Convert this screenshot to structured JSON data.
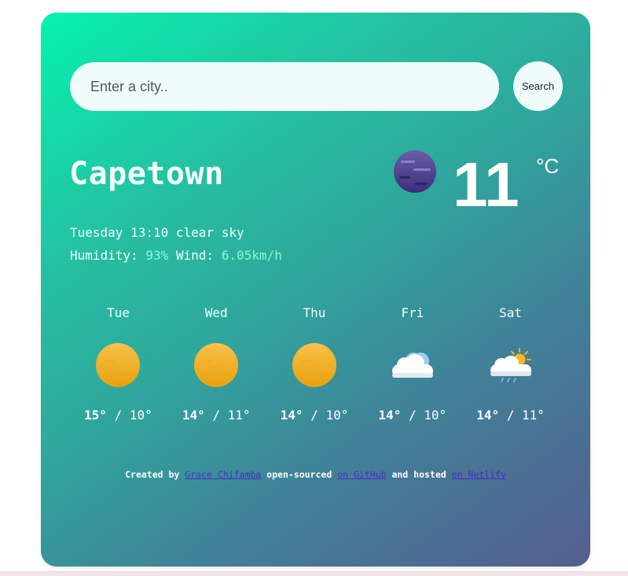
{
  "search": {
    "placeholder": "Enter a city..",
    "value": "",
    "button_label": "Search"
  },
  "current": {
    "city": "Capetown",
    "icon": "moon-icon",
    "temperature": "11",
    "unit": "°C",
    "day": "Tuesday",
    "time": "13:10",
    "description": "clear sky",
    "humidity_label": "Humidity:",
    "humidity": "93%",
    "wind_label": "Wind:",
    "wind": "6.05km/h"
  },
  "forecast": [
    {
      "day": "Tue",
      "icon": "sun-icon",
      "max": "15°",
      "min": "10°"
    },
    {
      "day": "Wed",
      "icon": "sun-icon",
      "max": "14°",
      "min": "11°"
    },
    {
      "day": "Thu",
      "icon": "sun-icon",
      "max": "14°",
      "min": "10°"
    },
    {
      "day": "Fri",
      "icon": "cloud-icon",
      "max": "14°",
      "min": "10°"
    },
    {
      "day": "Sat",
      "icon": "sun-cloud-rain-icon",
      "max": "14°",
      "min": "11°"
    }
  ],
  "footer": {
    "created_by": "Created by",
    "author": "Grace Chifamba",
    "open_sourced": "open-sourced",
    "github_link": "on GitHub",
    "hosted": "and hosted",
    "netlify_link": "on Netlify"
  },
  "colors": {
    "gradient_start": "#05f2b0",
    "gradient_end": "#555d90",
    "accent_text": "#8ff7d8",
    "link": "#4a2bc9"
  }
}
